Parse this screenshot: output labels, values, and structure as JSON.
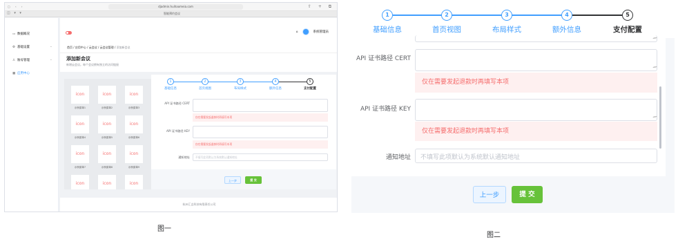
{
  "figure1": {
    "browser": {
      "url": "djadmin.huihaomeia.com",
      "tab_title": "智能预约会议"
    },
    "sidebar": {
      "items": [
        {
          "label": "数据概况",
          "icon": "monitor-icon"
        },
        {
          "label": "基础设置",
          "icon": "gear-icon"
        },
        {
          "label": "账号管理",
          "icon": "user-icon"
        },
        {
          "label": "应用中心",
          "icon": "grid-icon"
        }
      ]
    },
    "header": {
      "user_name": "系统管理员"
    },
    "breadcrumb": [
      "首页",
      "应用中心",
      "云会议",
      "云会议管理",
      "添加新会议"
    ],
    "page": {
      "title": "添加新会议",
      "subtitle": "新增云会议。每个会议拥有独立的访问链接"
    },
    "preview_tiles": [
      {
        "icon": "icon",
        "label": "示例菜单1"
      },
      {
        "icon": "icon",
        "label": "示例菜单2"
      },
      {
        "icon": "icon",
        "label": "示例菜单3"
      },
      {
        "icon": "icon",
        "label": "示例菜单4"
      },
      {
        "icon": "icon",
        "label": "示例菜单5"
      },
      {
        "icon": "icon",
        "label": "示例菜单6"
      },
      {
        "icon": "icon",
        "label": "示例菜单7"
      },
      {
        "icon": "icon",
        "label": "示例菜单8"
      },
      {
        "icon": "icon",
        "label": "示例菜单9"
      },
      {
        "icon": "icon",
        "label": ""
      },
      {
        "icon": "icon",
        "label": ""
      },
      {
        "icon": "icon",
        "label": ""
      }
    ],
    "steps": [
      {
        "num": "1",
        "label": "基础信息"
      },
      {
        "num": "2",
        "label": "首页视图"
      },
      {
        "num": "3",
        "label": "布局样式"
      },
      {
        "num": "4",
        "label": "额外信息"
      },
      {
        "num": "5",
        "label": "支付配置"
      }
    ],
    "form": {
      "cert_label": "API 证书路径 CERT",
      "cert_tip": "仅在需要发起退款时再填写本项",
      "key_label": "API 证书路径 KEY",
      "key_tip": "仅在需要发起退款时再填写本项",
      "notify_label": "通知地址",
      "notify_placeholder": "不填写此项默认为系统默认通知地址",
      "prev_button": "上一步",
      "submit_button": "提 交"
    },
    "footer": "杭州汇吉科技有限责任公司",
    "caption": "图一"
  },
  "figure2": {
    "steps": [
      {
        "num": "1",
        "label": "基础信息"
      },
      {
        "num": "2",
        "label": "首页视图"
      },
      {
        "num": "3",
        "label": "布局样式"
      },
      {
        "num": "4",
        "label": "额外信息"
      },
      {
        "num": "5",
        "label": "支付配置"
      }
    ],
    "form": {
      "cert_label": "API 证书路径 CERT",
      "cert_tip": "仅在需要发起退款时再填写本项",
      "key_label": "API 证书路径 KEY",
      "key_tip": "仅在需要发起退款时再填写本项",
      "notify_label": "通知地址",
      "notify_placeholder": "不填写此项默认为系统默认通知地址",
      "prev_button": "上一步",
      "submit_button": "提 交"
    },
    "caption": "图二"
  },
  "colors": {
    "primary": "#409eff",
    "success": "#67c23a",
    "danger": "#f56c6c",
    "danger_bg": "#fef0f0"
  }
}
